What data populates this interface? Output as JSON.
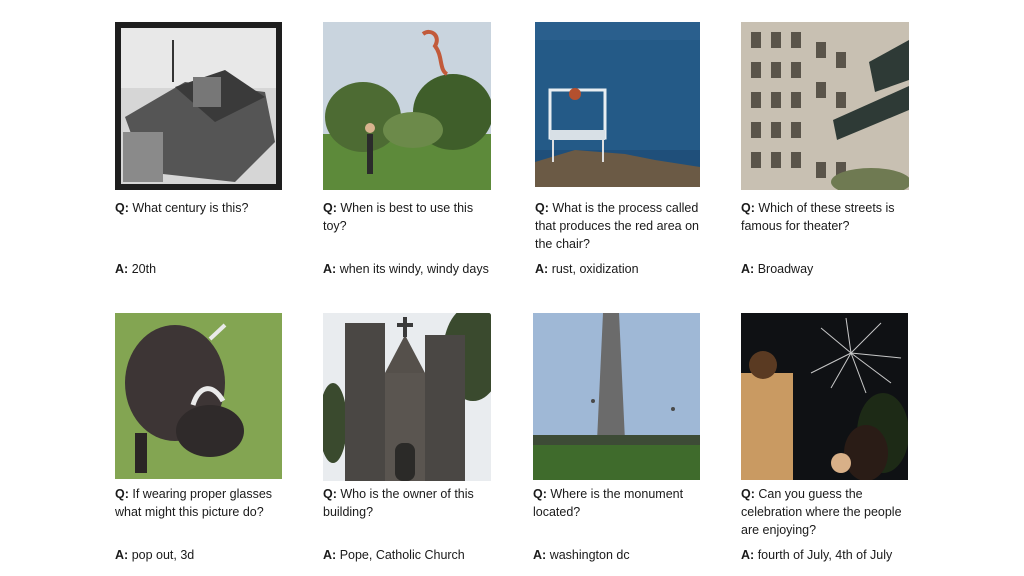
{
  "items": [
    {
      "question": "What century is this?",
      "answer": "20th",
      "image": "vintage-airplane-cockpit-photo"
    },
    {
      "question": "When is best to use this toy?",
      "answer": "when its windy, windy days",
      "image": "person-flying-kite-photo"
    },
    {
      "question": "What is the process called that produces the red area on the chair?",
      "answer": "rust, oxidization",
      "image": "chair-by-sea-photo"
    },
    {
      "question": "Which of these streets is famous for theater?",
      "answer": "Broadway",
      "image": "broadway-street-sign-photo"
    },
    {
      "question": "If wearing proper glasses what might this picture do?",
      "answer": "pop out, 3d",
      "image": "grazing-bull-photo"
    },
    {
      "question": "Who is the owner of this building?",
      "answer": "Pope, Catholic Church",
      "image": "cathedral-photo"
    },
    {
      "question": "Where is the monument located?",
      "answer": "washington dc",
      "image": "washington-monument-photo"
    },
    {
      "question": "Can you guess the celebration where the people are enjoying?",
      "answer": "fourth of July, 4th of July",
      "image": "fireworks-crowd-photo"
    }
  ],
  "labels": {
    "question": "Q:",
    "answer": "A:"
  }
}
